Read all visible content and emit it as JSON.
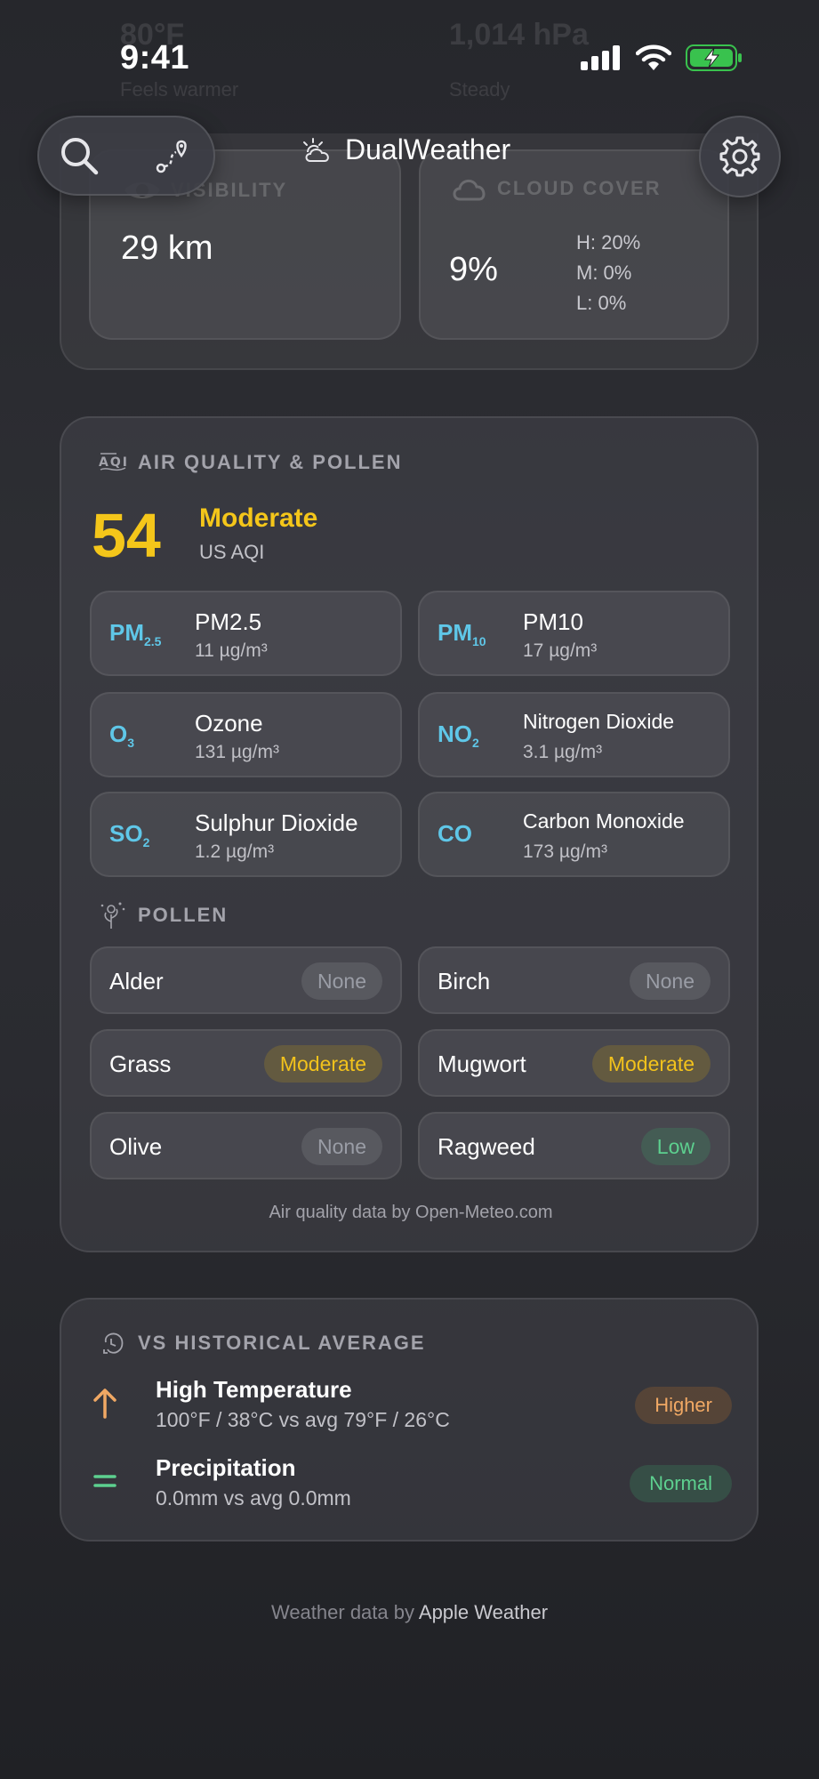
{
  "status_bar": {
    "time": "9:41"
  },
  "ghost": {
    "left_value": "80°F",
    "right_value": "1,014 hPa",
    "left_sub": "Feels warmer",
    "right_sub": "Steady"
  },
  "header": {
    "title": "DualWeather"
  },
  "visibility": {
    "label": "VISIBILITY",
    "value": "29 km"
  },
  "cloud_cover": {
    "label": "CLOUD COVER",
    "value": "9%",
    "high": "H:  20%",
    "mid": "M:  0%",
    "low": "L:  0%"
  },
  "air_quality": {
    "heading": "AIR QUALITY & POLLEN",
    "aqi_value": "54",
    "aqi_level": "Moderate",
    "aqi_scale": "US AQI",
    "pollutants": [
      {
        "symbol": "PM",
        "sub": "2.5",
        "name": "PM2.5",
        "value": "11 µg/m³"
      },
      {
        "symbol": "PM",
        "sub": "10",
        "name": "PM10",
        "value": "17 µg/m³"
      },
      {
        "symbol": "O",
        "sub": "3",
        "name": "Ozone",
        "value": "131 µg/m³"
      },
      {
        "symbol": "NO",
        "sub": "2",
        "name": "Nitrogen Dioxide",
        "value": "3.1 µg/m³"
      },
      {
        "symbol": "SO",
        "sub": "2",
        "name": "Sulphur Dioxide",
        "value": "1.2 µg/m³"
      },
      {
        "symbol": "CO",
        "sub": "",
        "name": "Carbon Monoxide",
        "value": "173 µg/m³"
      }
    ],
    "pollen_heading": "POLLEN",
    "pollen": [
      {
        "name": "Alder",
        "level": "None"
      },
      {
        "name": "Birch",
        "level": "None"
      },
      {
        "name": "Grass",
        "level": "Moderate"
      },
      {
        "name": "Mugwort",
        "level": "Moderate"
      },
      {
        "name": "Olive",
        "level": "None"
      },
      {
        "name": "Ragweed",
        "level": "Low"
      }
    ],
    "credit": "Air quality data by Open-Meteo.com"
  },
  "historical": {
    "heading": "VS HISTORICAL AVERAGE",
    "rows": [
      {
        "title": "High Temperature",
        "detail": "100°F / 38°C vs avg 79°F / 26°C",
        "status": "Higher",
        "icon": "arrow-up-icon"
      },
      {
        "title": "Precipitation",
        "detail": "0.0mm vs avg 0.0mm",
        "status": "Normal",
        "icon": "equals-icon"
      }
    ]
  },
  "footer": {
    "prefix": "Weather data by",
    "source": "Apple Weather"
  },
  "colors": {
    "aqi_moderate": "#f4c61a",
    "pollutant_symbol": "#5fc7e8",
    "higher": "#f0a864",
    "normal": "#5dd08f"
  }
}
